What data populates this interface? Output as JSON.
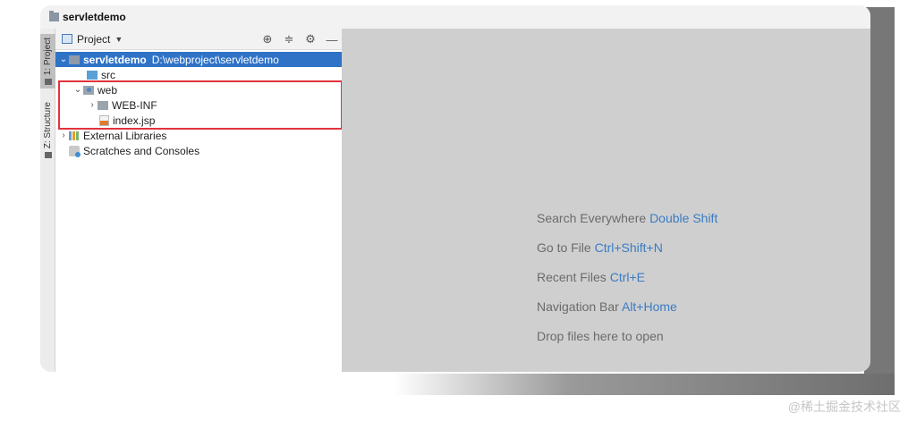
{
  "window": {
    "title": "servletdemo"
  },
  "tool_strip": {
    "tabs": [
      {
        "label": "1: Project",
        "active": true
      },
      {
        "label": "Z: Structure",
        "active": false
      }
    ]
  },
  "project_panel": {
    "header_label": "Project",
    "header_icons": [
      "crosshair-icon",
      "collapse-all-icon",
      "gear-icon",
      "minimize-icon"
    ],
    "tree": [
      {
        "label": "servletdemo",
        "path": "D:\\webproject\\servletdemo",
        "icon": "module-folder-icon",
        "expanded": true,
        "selected": true
      },
      {
        "label": "src",
        "icon": "source-folder-icon"
      },
      {
        "label": "web",
        "icon": "web-folder-icon",
        "expanded": true
      },
      {
        "label": "WEB-INF",
        "icon": "folder-icon",
        "expanded": false
      },
      {
        "label": "index.jsp",
        "icon": "jsp-file-icon"
      },
      {
        "label": "External Libraries",
        "icon": "libraries-icon",
        "expanded": false
      },
      {
        "label": "Scratches and Consoles",
        "icon": "scratches-icon"
      }
    ]
  },
  "editor_hints": [
    {
      "text": "Search Everywhere",
      "shortcut": "Double Shift"
    },
    {
      "text": "Go to File",
      "shortcut": "Ctrl+Shift+N"
    },
    {
      "text": "Recent Files",
      "shortcut": "Ctrl+E"
    },
    {
      "text": "Navigation Bar",
      "shortcut": "Alt+Home"
    },
    {
      "text": "Drop files here to open",
      "shortcut": ""
    }
  ],
  "watermark": "@稀土掘金技术社区",
  "colors": {
    "selection": "#2f73c7",
    "highlight_box": "#e0343c",
    "shortcut": "#3a7cc4",
    "editor_bg": "#cfcfcf"
  }
}
